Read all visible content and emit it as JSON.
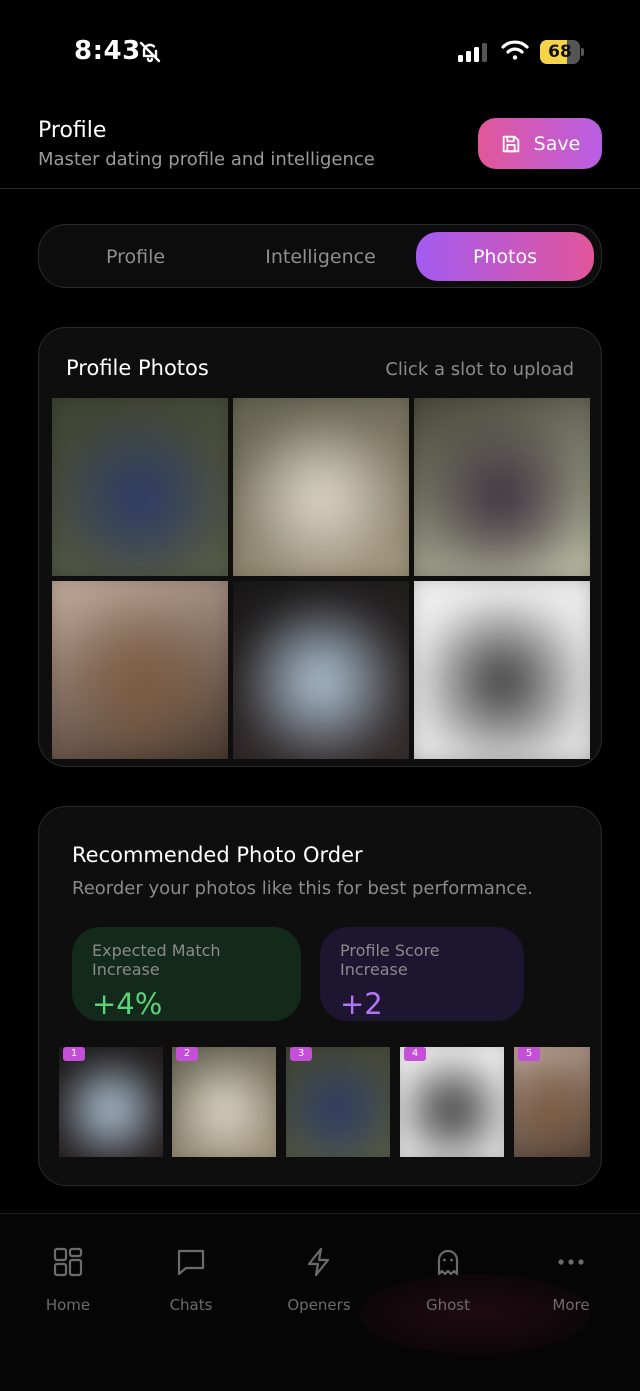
{
  "status_bar": {
    "time": "8:43",
    "battery": "68",
    "battery_level": 0.68
  },
  "header": {
    "title": "Profile",
    "subtitle": "Master dating profile and intelligence",
    "save_label": "Save"
  },
  "tabs": [
    {
      "label": "Profile",
      "active": false
    },
    {
      "label": "Intelligence",
      "active": false
    },
    {
      "label": "Photos",
      "active": true
    }
  ],
  "photos_card": {
    "title": "Profile Photos",
    "hint": "Click a slot to upload",
    "slots": [
      {
        "colors": [
          "#3b4030",
          "#2b3a6a",
          "#5a5e4a"
        ]
      },
      {
        "colors": [
          "#5a5a4a",
          "#e3ddd0",
          "#a89a80"
        ]
      },
      {
        "colors": [
          "#3a3a2e",
          "#3b2f3d",
          "#c8c8b0"
        ]
      },
      {
        "colors": [
          "#d0b8a8",
          "#7a5a40",
          "#3a2a20"
        ]
      },
      {
        "colors": [
          "#151515",
          "#b8cde0",
          "#3a3030"
        ]
      },
      {
        "colors": [
          "#f2f2f2",
          "#333333",
          "#dddddd"
        ]
      }
    ]
  },
  "order_card": {
    "title": "Recommended Photo Order",
    "subtitle": "Reorder your photos like this for best performance.",
    "match_label": "Expected Match Increase",
    "match_value": "+4%",
    "score_label": "Profile Score Increase",
    "score_value": "+2",
    "order": [
      {
        "badge": "1",
        "colors": [
          "#1a1a1a",
          "#b8cde0",
          "#2a2222"
        ]
      },
      {
        "badge": "2",
        "colors": [
          "#5a5a4a",
          "#e3ddd0",
          "#a89a80"
        ]
      },
      {
        "badge": "3",
        "colors": [
          "#3b4030",
          "#2b3a6a",
          "#5a5e4a"
        ]
      },
      {
        "badge": "4",
        "colors": [
          "#f2f2f2",
          "#333333",
          "#dddddd"
        ]
      },
      {
        "badge": "5",
        "colors": [
          "#d0b8a8",
          "#7a5a40",
          "#3a2a20"
        ]
      }
    ]
  },
  "nav": [
    {
      "label": "Home",
      "icon": "grid-icon"
    },
    {
      "label": "Chats",
      "icon": "chat-bubble-icon"
    },
    {
      "label": "Openers",
      "icon": "lightning-icon"
    },
    {
      "label": "Ghost",
      "icon": "ghost-icon"
    },
    {
      "label": "More",
      "icon": "more-dots-icon"
    }
  ]
}
